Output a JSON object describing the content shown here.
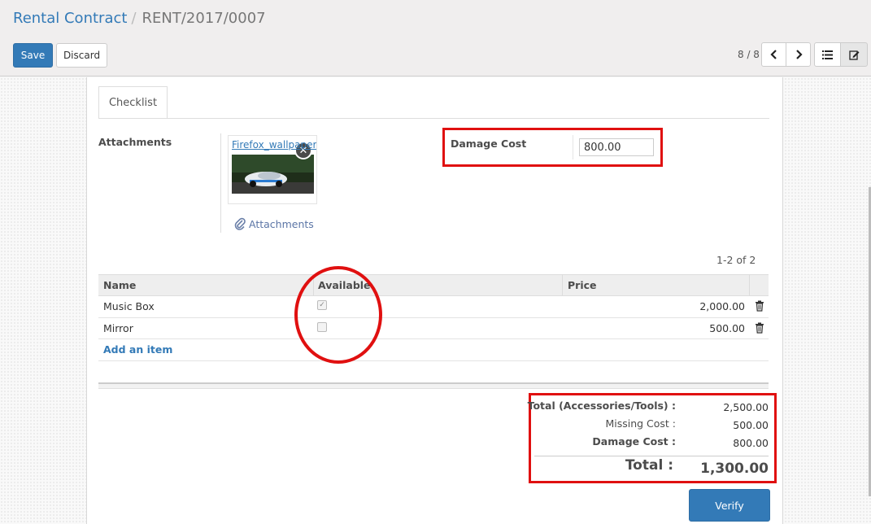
{
  "breadcrumb": {
    "parent": "Rental Contract",
    "separator": "/",
    "current": "RENT/2017/0007"
  },
  "toolbar": {
    "save_label": "Save",
    "discard_label": "Discard"
  },
  "pager": {
    "value": "8 / 8"
  },
  "icons": {
    "prev": "chevron-left-icon",
    "next": "chevron-right-icon",
    "list_view": "list-icon",
    "form_view": "edit-icon"
  },
  "tabs": [
    {
      "label": "Checklist"
    }
  ],
  "attachments": {
    "label": "Attachments",
    "file_name": "Firefox_wallpaper.png",
    "link_label": "Attachments"
  },
  "damage": {
    "label": "Damage Cost",
    "value": "800.00"
  },
  "lines": {
    "pager": "1-2 of 2",
    "columns": [
      "Name",
      "Available",
      "Price"
    ],
    "rows": [
      {
        "name": "Music Box",
        "available": true,
        "price": "2,000.00"
      },
      {
        "name": "Mirror",
        "available": false,
        "price": "500.00"
      }
    ],
    "add_item": "Add an item"
  },
  "totals": {
    "accessories_label": "Total (Accessories/Tools) :",
    "accessories_value": "2,500.00",
    "missing_label": "Missing Cost :",
    "missing_value": "500.00",
    "damage_label": "Damage Cost :",
    "damage_value": "800.00",
    "total_label": "Total :",
    "total_value": "1,300.00"
  },
  "verify_label": "Verify",
  "colors": {
    "primary": "#337ab7",
    "annotation": "#e01010"
  }
}
